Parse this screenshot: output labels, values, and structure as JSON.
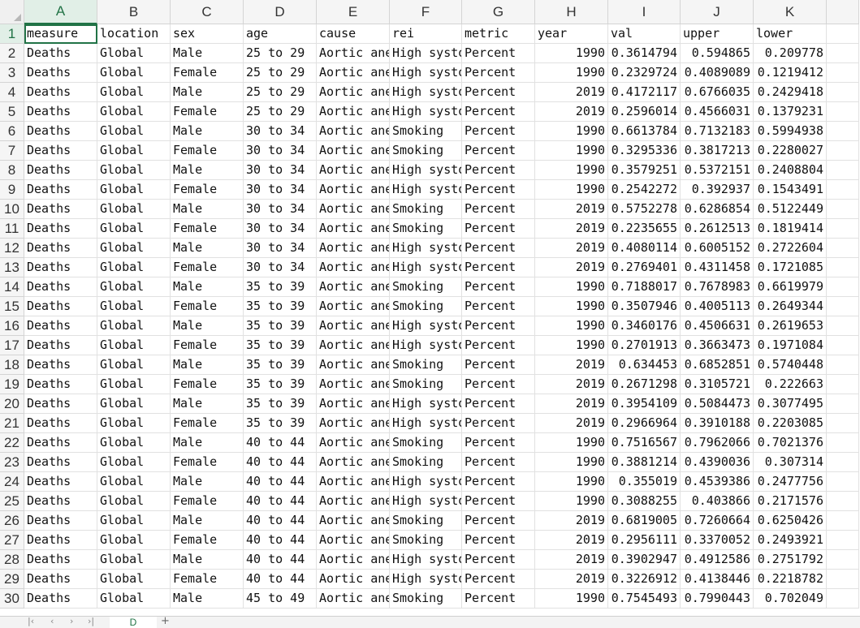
{
  "columns": [
    "A",
    "B",
    "C",
    "D",
    "E",
    "F",
    "G",
    "H",
    "I",
    "J",
    "K"
  ],
  "rows": [
    {
      "n": "1",
      "cells": [
        "measure",
        "location",
        "sex",
        "age",
        "cause",
        "rei",
        "metric",
        "year",
        "val",
        "upper",
        "lower"
      ]
    },
    {
      "n": "2",
      "cells": [
        "Deaths",
        "Global",
        "Male",
        "25 to 29",
        "Aortic ane",
        "High systo",
        "Percent",
        "1990",
        "0.3614794",
        "0.594865",
        "0.209778"
      ]
    },
    {
      "n": "3",
      "cells": [
        "Deaths",
        "Global",
        "Female",
        "25 to 29",
        "Aortic ane",
        "High systo",
        "Percent",
        "1990",
        "0.2329724",
        "0.4089089",
        "0.1219412"
      ]
    },
    {
      "n": "4",
      "cells": [
        "Deaths",
        "Global",
        "Male",
        "25 to 29",
        "Aortic ane",
        "High systo",
        "Percent",
        "2019",
        "0.4172117",
        "0.6766035",
        "0.2429418"
      ]
    },
    {
      "n": "5",
      "cells": [
        "Deaths",
        "Global",
        "Female",
        "25 to 29",
        "Aortic ane",
        "High systo",
        "Percent",
        "2019",
        "0.2596014",
        "0.4566031",
        "0.1379231"
      ]
    },
    {
      "n": "6",
      "cells": [
        "Deaths",
        "Global",
        "Male",
        "30 to 34",
        "Aortic ane",
        "Smoking",
        "Percent",
        "1990",
        "0.6613784",
        "0.7132183",
        "0.5994938"
      ]
    },
    {
      "n": "7",
      "cells": [
        "Deaths",
        "Global",
        "Female",
        "30 to 34",
        "Aortic ane",
        "Smoking",
        "Percent",
        "1990",
        "0.3295336",
        "0.3817213",
        "0.2280027"
      ]
    },
    {
      "n": "8",
      "cells": [
        "Deaths",
        "Global",
        "Male",
        "30 to 34",
        "Aortic ane",
        "High systo",
        "Percent",
        "1990",
        "0.3579251",
        "0.5372151",
        "0.2408804"
      ]
    },
    {
      "n": "9",
      "cells": [
        "Deaths",
        "Global",
        "Female",
        "30 to 34",
        "Aortic ane",
        "High systo",
        "Percent",
        "1990",
        "0.2542272",
        "0.392937",
        "0.1543491"
      ]
    },
    {
      "n": "10",
      "cells": [
        "Deaths",
        "Global",
        "Male",
        "30 to 34",
        "Aortic ane",
        "Smoking",
        "Percent",
        "2019",
        "0.5752278",
        "0.6286854",
        "0.5122449"
      ]
    },
    {
      "n": "11",
      "cells": [
        "Deaths",
        "Global",
        "Female",
        "30 to 34",
        "Aortic ane",
        "Smoking",
        "Percent",
        "2019",
        "0.2235655",
        "0.2612513",
        "0.1819414"
      ]
    },
    {
      "n": "12",
      "cells": [
        "Deaths",
        "Global",
        "Male",
        "30 to 34",
        "Aortic ane",
        "High systo",
        "Percent",
        "2019",
        "0.4080114",
        "0.6005152",
        "0.2722604"
      ]
    },
    {
      "n": "13",
      "cells": [
        "Deaths",
        "Global",
        "Female",
        "30 to 34",
        "Aortic ane",
        "High systo",
        "Percent",
        "2019",
        "0.2769401",
        "0.4311458",
        "0.1721085"
      ]
    },
    {
      "n": "14",
      "cells": [
        "Deaths",
        "Global",
        "Male",
        "35 to 39",
        "Aortic ane",
        "Smoking",
        "Percent",
        "1990",
        "0.7188017",
        "0.7678983",
        "0.6619979"
      ]
    },
    {
      "n": "15",
      "cells": [
        "Deaths",
        "Global",
        "Female",
        "35 to 39",
        "Aortic ane",
        "Smoking",
        "Percent",
        "1990",
        "0.3507946",
        "0.4005113",
        "0.2649344"
      ]
    },
    {
      "n": "16",
      "cells": [
        "Deaths",
        "Global",
        "Male",
        "35 to 39",
        "Aortic ane",
        "High systo",
        "Percent",
        "1990",
        "0.3460176",
        "0.4506631",
        "0.2619653"
      ]
    },
    {
      "n": "17",
      "cells": [
        "Deaths",
        "Global",
        "Female",
        "35 to 39",
        "Aortic ane",
        "High systo",
        "Percent",
        "1990",
        "0.2701913",
        "0.3663473",
        "0.1971084"
      ]
    },
    {
      "n": "18",
      "cells": [
        "Deaths",
        "Global",
        "Male",
        "35 to 39",
        "Aortic ane",
        "Smoking",
        "Percent",
        "2019",
        "0.634453",
        "0.6852851",
        "0.5740448"
      ]
    },
    {
      "n": "19",
      "cells": [
        "Deaths",
        "Global",
        "Female",
        "35 to 39",
        "Aortic ane",
        "Smoking",
        "Percent",
        "2019",
        "0.2671298",
        "0.3105721",
        "0.222663"
      ]
    },
    {
      "n": "20",
      "cells": [
        "Deaths",
        "Global",
        "Male",
        "35 to 39",
        "Aortic ane",
        "High systo",
        "Percent",
        "2019",
        "0.3954109",
        "0.5084473",
        "0.3077495"
      ]
    },
    {
      "n": "21",
      "cells": [
        "Deaths",
        "Global",
        "Female",
        "35 to 39",
        "Aortic ane",
        "High systo",
        "Percent",
        "2019",
        "0.2966964",
        "0.3910188",
        "0.2203085"
      ]
    },
    {
      "n": "22",
      "cells": [
        "Deaths",
        "Global",
        "Male",
        "40 to 44",
        "Aortic ane",
        "Smoking",
        "Percent",
        "1990",
        "0.7516567",
        "0.7962066",
        "0.7021376"
      ]
    },
    {
      "n": "23",
      "cells": [
        "Deaths",
        "Global",
        "Female",
        "40 to 44",
        "Aortic ane",
        "Smoking",
        "Percent",
        "1990",
        "0.3881214",
        "0.4390036",
        "0.307314"
      ]
    },
    {
      "n": "24",
      "cells": [
        "Deaths",
        "Global",
        "Male",
        "40 to 44",
        "Aortic ane",
        "High systo",
        "Percent",
        "1990",
        "0.355019",
        "0.4539386",
        "0.2477756"
      ]
    },
    {
      "n": "25",
      "cells": [
        "Deaths",
        "Global",
        "Female",
        "40 to 44",
        "Aortic ane",
        "High systo",
        "Percent",
        "1990",
        "0.3088255",
        "0.403866",
        "0.2171576"
      ]
    },
    {
      "n": "26",
      "cells": [
        "Deaths",
        "Global",
        "Male",
        "40 to 44",
        "Aortic ane",
        "Smoking",
        "Percent",
        "2019",
        "0.6819005",
        "0.7260664",
        "0.6250426"
      ]
    },
    {
      "n": "27",
      "cells": [
        "Deaths",
        "Global",
        "Female",
        "40 to 44",
        "Aortic ane",
        "Smoking",
        "Percent",
        "2019",
        "0.2956111",
        "0.3370052",
        "0.2493921"
      ]
    },
    {
      "n": "28",
      "cells": [
        "Deaths",
        "Global",
        "Male",
        "40 to 44",
        "Aortic ane",
        "High systo",
        "Percent",
        "2019",
        "0.3902947",
        "0.4912586",
        "0.2751792"
      ]
    },
    {
      "n": "29",
      "cells": [
        "Deaths",
        "Global",
        "Female",
        "40 to 44",
        "Aortic ane",
        "High systo",
        "Percent",
        "2019",
        "0.3226912",
        "0.4138446",
        "0.2218782"
      ]
    },
    {
      "n": "30",
      "cells": [
        "Deaths",
        "Global",
        "Male",
        "45 to 49",
        "Aortic ane",
        "Smoking",
        "Percent",
        "1990",
        "0.7545493",
        "0.7990443",
        "0.702049"
      ]
    }
  ],
  "selection": {
    "column": "A",
    "row": "1"
  },
  "sheet_tab": {
    "label": "D"
  },
  "colors": {
    "accent": "#217346",
    "header_bg": "#f5f5f5",
    "gridline": "#e1e1e1"
  }
}
